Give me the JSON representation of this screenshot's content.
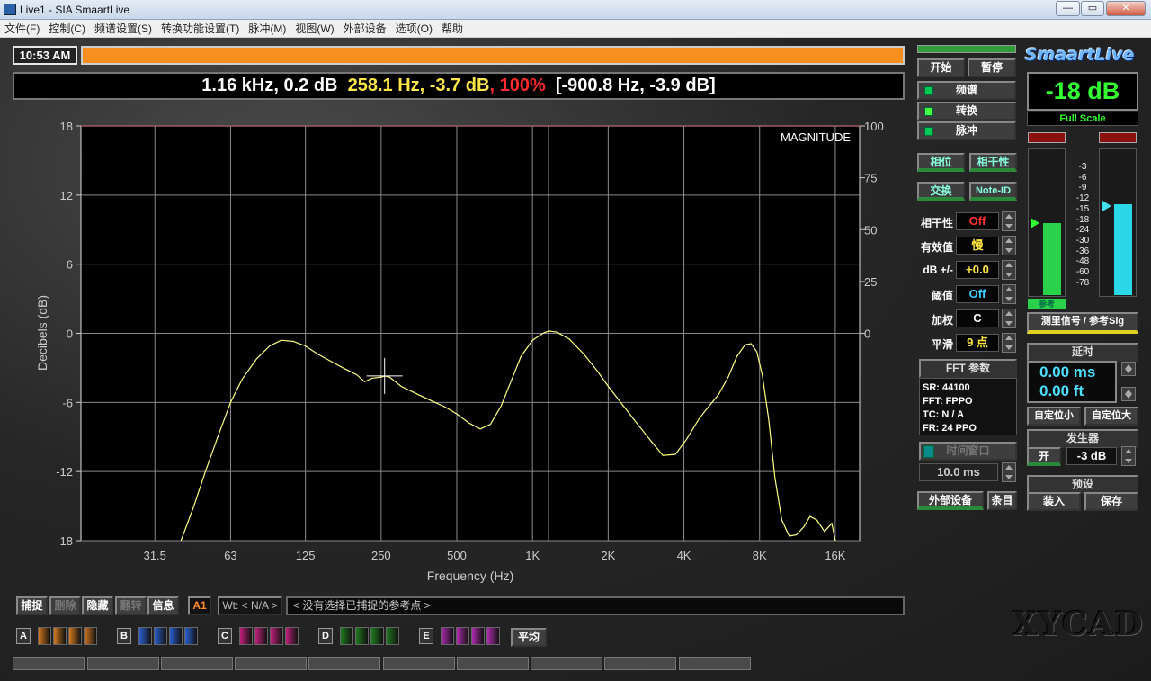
{
  "window": {
    "title": "Live1 - SIA SmaartLive"
  },
  "menu": [
    "文件(F)",
    "控制(C)",
    "频谱设置(S)",
    "转换功能设置(T)",
    "脉冲(M)",
    "视图(W)",
    "外部设备",
    "选项(O)",
    "帮助"
  ],
  "clock": "10:53 AM",
  "readout": {
    "part1": "1.16 kHz, 0.2 dB",
    "part2": "258.1 Hz, -3.7 dB",
    "comma": ",",
    "part3": "100%",
    "part4": "[-900.8 Hz, -3.9 dB]"
  },
  "chart_data": {
    "type": "line",
    "title": "MAGNITUDE",
    "xlabel": "Frequency (Hz)",
    "ylabel": "Decibels (dB)",
    "x_scale": "log",
    "xlim": [
      16,
      20000
    ],
    "ylim": [
      -18,
      18
    ],
    "y2lim": [
      -100,
      100
    ],
    "x_ticks": [
      31.5,
      63,
      125,
      250,
      500,
      1000,
      2000,
      4000,
      8000,
      16000
    ],
    "x_tick_labels": [
      "31.5",
      "63",
      "125",
      "250",
      "500",
      "1K",
      "2K",
      "4K",
      "8K",
      "16K"
    ],
    "y_ticks": [
      18,
      12,
      6,
      0,
      -6,
      -12,
      -18
    ],
    "y2_ticks": [
      100,
      75,
      50,
      25,
      0
    ],
    "grid": true,
    "series": [
      {
        "color": "#ffff80",
        "points": [
          [
            40,
            -18
          ],
          [
            45,
            -15
          ],
          [
            50,
            -12
          ],
          [
            56,
            -9
          ],
          [
            63,
            -6
          ],
          [
            70,
            -4
          ],
          [
            80,
            -2.2
          ],
          [
            90,
            -1.1
          ],
          [
            100,
            -0.6
          ],
          [
            112,
            -0.7
          ],
          [
            125,
            -1.1
          ],
          [
            140,
            -1.8
          ],
          [
            160,
            -2.5
          ],
          [
            180,
            -3.1
          ],
          [
            200,
            -3.6
          ],
          [
            215,
            -4.2
          ],
          [
            230,
            -3.9
          ],
          [
            250,
            -3.8
          ],
          [
            258,
            -3.7
          ],
          [
            270,
            -3.8
          ],
          [
            300,
            -4.6
          ],
          [
            350,
            -5.3
          ],
          [
            400,
            -5.9
          ],
          [
            450,
            -6.4
          ],
          [
            500,
            -7.0
          ],
          [
            560,
            -7.8
          ],
          [
            620,
            -8.3
          ],
          [
            680,
            -7.9
          ],
          [
            750,
            -6.3
          ],
          [
            820,
            -4.2
          ],
          [
            900,
            -2.0
          ],
          [
            1000,
            -0.6
          ],
          [
            1100,
            0.0
          ],
          [
            1160,
            0.2
          ],
          [
            1250,
            0.1
          ],
          [
            1400,
            -0.5
          ],
          [
            1600,
            -1.8
          ],
          [
            1800,
            -3.2
          ],
          [
            2000,
            -4.6
          ],
          [
            2300,
            -6.3
          ],
          [
            2600,
            -7.8
          ],
          [
            3000,
            -9.5
          ],
          [
            3300,
            -10.6
          ],
          [
            3700,
            -10.5
          ],
          [
            4100,
            -9.2
          ],
          [
            4600,
            -7.4
          ],
          [
            5000,
            -6.4
          ],
          [
            5500,
            -5.3
          ],
          [
            6000,
            -3.8
          ],
          [
            6500,
            -2.0
          ],
          [
            7000,
            -1.0
          ],
          [
            7400,
            -0.9
          ],
          [
            7800,
            -1.6
          ],
          [
            8200,
            -3.6
          ],
          [
            8700,
            -7.5
          ],
          [
            9200,
            -12.5
          ],
          [
            9800,
            -16.2
          ],
          [
            10500,
            -17.6
          ],
          [
            11200,
            -17.5
          ],
          [
            12000,
            -16.8
          ],
          [
            12700,
            -15.9
          ],
          [
            13500,
            -16.2
          ],
          [
            14500,
            -17.2
          ],
          [
            15500,
            -16.5
          ],
          [
            16000,
            -18
          ]
        ]
      }
    ],
    "cursor": {
      "freq": 258.1,
      "db": -3.7
    },
    "marker": {
      "freq": 1160,
      "db": 0.2
    }
  },
  "left_buttons": {
    "capture": "捕捉",
    "delete": "删除",
    "hide": "隐藏",
    "flip": "翻转",
    "info": "信息"
  },
  "ref_slot": "A1",
  "wt": "Wt: < N/A >",
  "ref_text": "<   没有选择已捕捉的参考点     >",
  "channels": [
    {
      "label": "A",
      "color": "#d2781e"
    },
    {
      "label": "B",
      "color": "#2a5fd0"
    },
    {
      "label": "C",
      "color": "#c01f7a"
    },
    {
      "label": "D",
      "color": "#1f7a1f"
    },
    {
      "label": "E",
      "color": "#b02ab0"
    }
  ],
  "avg_label": "平均",
  "right": {
    "start": "开始",
    "pause": "暂停",
    "spectrum": "频谱",
    "transfer": "转换",
    "impulse": "脉冲",
    "phase": "相位",
    "coherence_btn": "相干性",
    "swap": "交换",
    "noteid": "Note-ID",
    "logo": "SmaartLive",
    "level": "-18 dB",
    "full_scale": "Full Scale",
    "meter_scale": [
      "-3",
      "-6",
      "-9",
      "-12",
      "-15",
      "-18",
      "-24",
      "-30",
      "-36",
      "-48",
      "-60",
      "-78"
    ],
    "meter_left_level": 0.5,
    "meter_right_level": 0.63,
    "params": [
      {
        "label": "相干性",
        "value": "Off",
        "color": "#ff3030"
      },
      {
        "label": "有效值",
        "value": "慢",
        "color": "#ffe640"
      },
      {
        "label": "dB +/-",
        "value": "+0.0",
        "color": "#ffe640"
      },
      {
        "label": "阈值",
        "value": "Off",
        "color": "#3ad0ff"
      },
      {
        "label": "加权",
        "value": "C",
        "color": "#ffffff"
      },
      {
        "label": "平滑",
        "value": "9 点",
        "color": "#ffe640"
      }
    ],
    "meter_tag": "参考",
    "sig_btn": "测里信号 / 参考Sig",
    "fft_title": "FFT 参数",
    "fft": [
      "SR: 44100",
      "FFT: FPPO",
      "TC: N / A",
      "FR: 24 PPO"
    ],
    "delay_title": "延时",
    "delay_ms": "0.00 ms",
    "delay_ft": "0.00 ft",
    "locate_small": "自定位小",
    "locate_large": "自定位大",
    "timewin": "时间窗口",
    "timewin_val": "10.0 ms",
    "gen_title": "发生器",
    "gen_on": "开",
    "gen_level": "-3 dB",
    "ext": "外部设备",
    "bar": "条目",
    "preset_title": "预设",
    "load": "装入",
    "save": "保存"
  },
  "watermark": "XYCAD"
}
